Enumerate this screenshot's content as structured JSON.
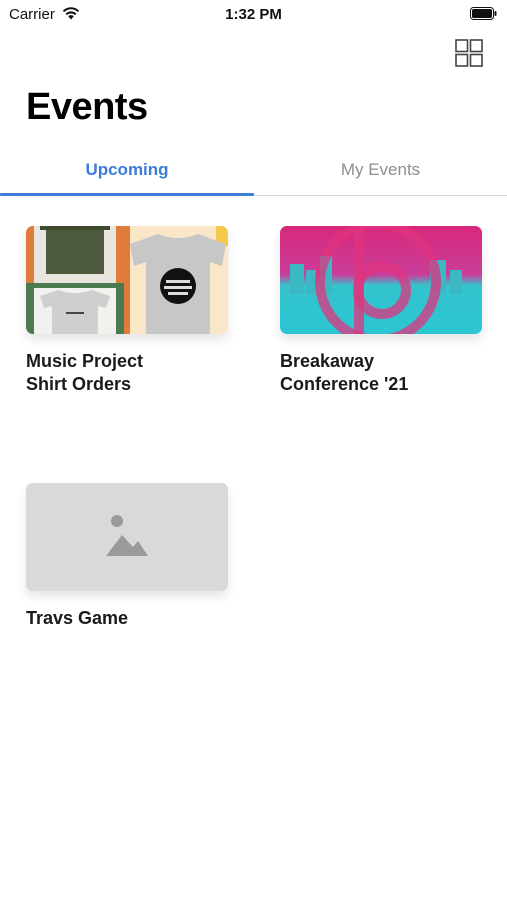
{
  "status_bar": {
    "carrier": "Carrier",
    "time": "1:32 PM",
    "wifi_icon": "wifi-icon",
    "battery_icon": "battery-icon"
  },
  "header": {
    "title": "Events",
    "view_toggle_icon": "grid-view-icon"
  },
  "tabs": [
    {
      "label": "Upcoming",
      "active": true
    },
    {
      "label": "My Events",
      "active": false
    }
  ],
  "events": [
    {
      "title": "Music Project\nShirt Orders",
      "image": "shirts-collage-image"
    },
    {
      "title": "Breakaway\nConference '21",
      "image": "conference-logo-image"
    },
    {
      "title": "Travs Game",
      "image": "placeholder-image-icon"
    }
  ],
  "colors": {
    "accent": "#3b7dd8",
    "inactive_tab": "#8e8e93",
    "placeholder_bg": "#d9d9d9",
    "placeholder_icon": "#9a9a9a"
  }
}
